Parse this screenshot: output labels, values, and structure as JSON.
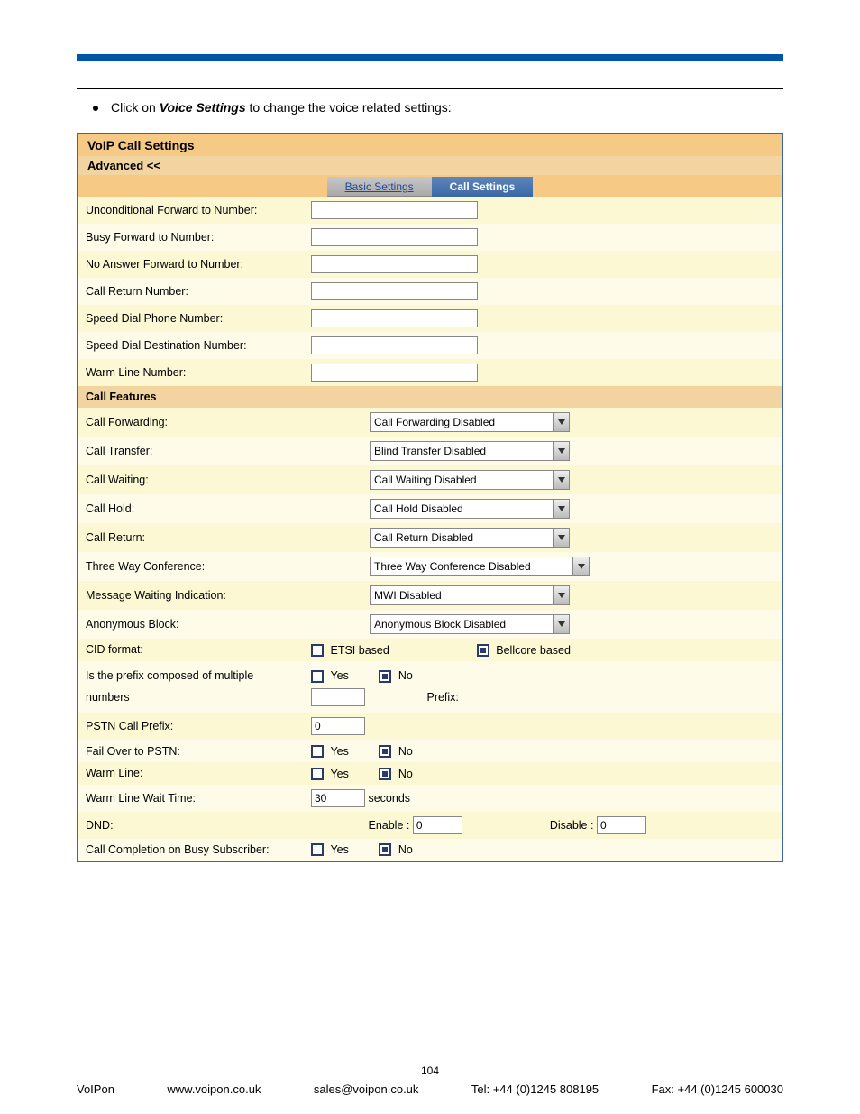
{
  "header_bar": true,
  "bullet": {
    "prefix": "Click on ",
    "emph": "Voice Settings",
    "suffix": " to change the voice related settings:"
  },
  "panel": {
    "title": "VoIP Call Settings",
    "advanced_button": "Advanced <<",
    "tabs": {
      "inactive": "Basic Settings",
      "active": "Call Settings"
    }
  },
  "basic": {
    "unconditional_forward": "Unconditional Forward to Number:",
    "busy_forward": "Busy Forward to Number:",
    "no_answer_forward": "No Answer Forward to Number:",
    "call_return": "Call Return Number:",
    "speed_dial_phone": "Speed Dial Phone Number:",
    "speed_dial_dest": "Speed Dial Destination Number:",
    "warm_line": "Warm Line Number:"
  },
  "features": {
    "header": "Call Features",
    "labels": {
      "call_forward": "Call Forwarding:",
      "call_transfer": "Call Transfer:",
      "call_waiting": "Call Waiting:",
      "call_hold": "Call Hold:",
      "call_return": "Call Return:",
      "three_way": "Three Way Conference:",
      "mwi": "Message Waiting Indication:",
      "anonymous_block": "Anonymous Block:",
      "cid_format": "CID format:",
      "multiple_prefix": "Is the prefix composed of multiple numbers",
      "pstn_prefix": "PSTN Call Prefix:",
      "failover_pstn": "Fail Over to PSTN:",
      "warm_line": "Warm Line:",
      "warm_time": "Warm Line Wait Time:",
      "dnd": "DND:",
      "call_completion": "Call Completion on Busy Subscriber:"
    },
    "selects": {
      "call_forward": "Call Forwarding Disabled",
      "call_transfer": "Blind Transfer Disabled",
      "call_waiting": "Call Waiting Disabled",
      "call_hold": "Call Hold Disabled",
      "call_return": "Call Return Disabled",
      "three_way": "Three Way Conference Disabled",
      "mwi": "MWI Disabled",
      "anonymous_block": "Anonymous Block Disabled"
    },
    "cid": {
      "etsi": "ETSI based",
      "bellcore": "Bellcore based"
    },
    "prefix": {
      "yes": "Yes",
      "no": "No",
      "label": "Prefix:"
    },
    "pstn_value": "0",
    "failover": {
      "yes": "Yes",
      "no": "No"
    },
    "warm": {
      "yes": "Yes",
      "no": "No"
    },
    "warm_time_value": "30",
    "warm_time_unit": "seconds",
    "dnd": {
      "enable_label": "Enable :",
      "enable_value": "0",
      "disable_label": "Disable :",
      "disable_value": "0"
    },
    "callcomp": {
      "yes": "Yes",
      "no": "No"
    }
  },
  "footer": {
    "page": "104",
    "voipon": "VoIPon",
    "url": "www.voipon.co.uk",
    "email": "sales@voipon.co.uk",
    "tel": "Tel: +44 (0)1245 808195",
    "fax": "Fax: +44 (0)1245 600030"
  }
}
